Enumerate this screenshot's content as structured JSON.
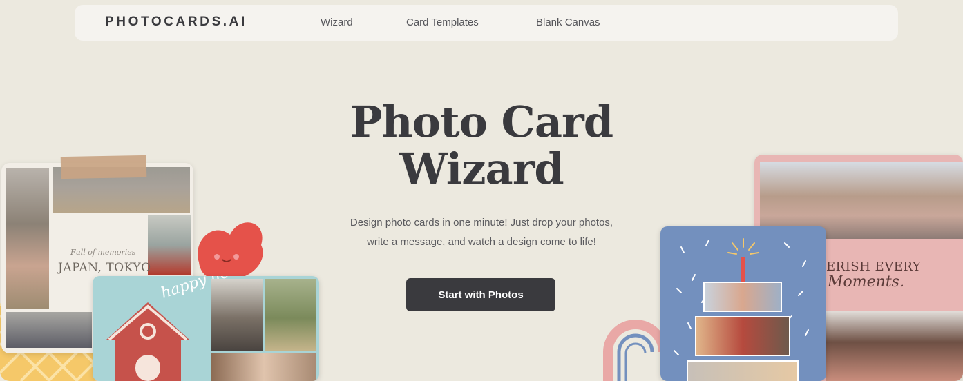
{
  "nav": {
    "logo": "PHOTOCARDS.AI",
    "links": [
      {
        "label": "Wizard"
      },
      {
        "label": "Card Templates"
      },
      {
        "label": "Blank Canvas"
      }
    ]
  },
  "hero": {
    "title_line1": "Photo Card",
    "title_line2": "Wizard",
    "subtitle_line1": "Design photo cards in one minute! Just drop your photos,",
    "subtitle_line2": "write a message, and watch a design come to life!",
    "cta_label": "Start with Photos"
  },
  "cards": {
    "japan": {
      "script_text": "Full of memories",
      "title": "JAPAN, TOKYO"
    },
    "holiday": {
      "script_text": "happy holidays!"
    },
    "cherish": {
      "title": "ERISH EVERY",
      "script_text": "Moments."
    }
  },
  "colors": {
    "background": "#ece9df",
    "nav_bg": "#f5f3ef",
    "text_dark": "#3a3a3e",
    "cta_bg": "#3a3a3e",
    "holiday_card": "#a9d4d6",
    "birthday_card": "#7390be",
    "cherish_card": "#e8b6b4"
  }
}
